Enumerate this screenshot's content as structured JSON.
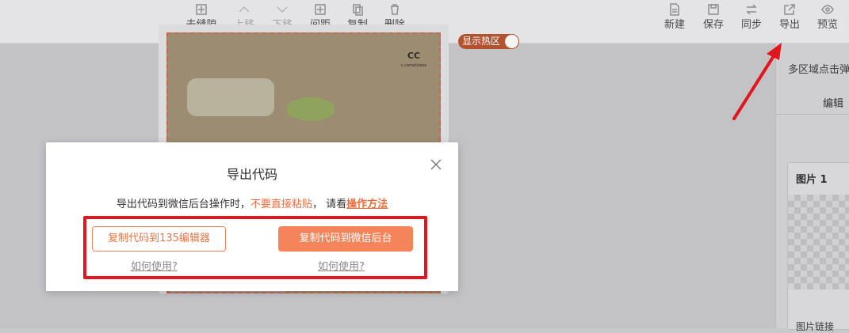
{
  "toolbar": {
    "left_tools": [
      {
        "label": "去缝隙",
        "icon": "plus-square-icon",
        "enabled": true
      },
      {
        "label": "上移",
        "icon": "chevron-up-icon",
        "enabled": false
      },
      {
        "label": "下移",
        "icon": "chevron-down-icon",
        "enabled": false
      },
      {
        "label": "间距",
        "icon": "plus-square-icon",
        "enabled": true
      },
      {
        "label": "复制",
        "icon": "copy-icon",
        "enabled": true
      },
      {
        "label": "删除",
        "icon": "trash-icon",
        "enabled": true
      }
    ],
    "right_tools": [
      {
        "label": "新建",
        "icon": "new-file-icon"
      },
      {
        "label": "保存",
        "icon": "save-icon"
      },
      {
        "label": "同步",
        "icon": "sync-icon"
      },
      {
        "label": "导出",
        "icon": "export-icon"
      },
      {
        "label": "预览",
        "icon": "eye-icon"
      }
    ]
  },
  "canvas": {
    "hot_zone_toggle": "显示热区",
    "logo_text": "CC",
    "logo_sub": "c.cameliness"
  },
  "right_panel": {
    "hint": "多区域点击弹",
    "tab": "编辑",
    "card_title": "图片 1",
    "link_label": "图片链接"
  },
  "modal": {
    "title": "导出代码",
    "desc_prefix": "导出代码到微信后台操作时，",
    "desc_warn": "不要直接粘贴",
    "desc_mid": "， 请看",
    "desc_link": "操作方法",
    "btn_copy_135": "复制代码到135编辑器",
    "btn_copy_wechat": "复制代码到微信后台",
    "how_to_use_1": "如何使用?",
    "how_to_use_2": "如何使用?"
  },
  "colors": {
    "accent": "#f5845a",
    "highlight": "#e3151d",
    "warning_text": "#f26a3a"
  }
}
